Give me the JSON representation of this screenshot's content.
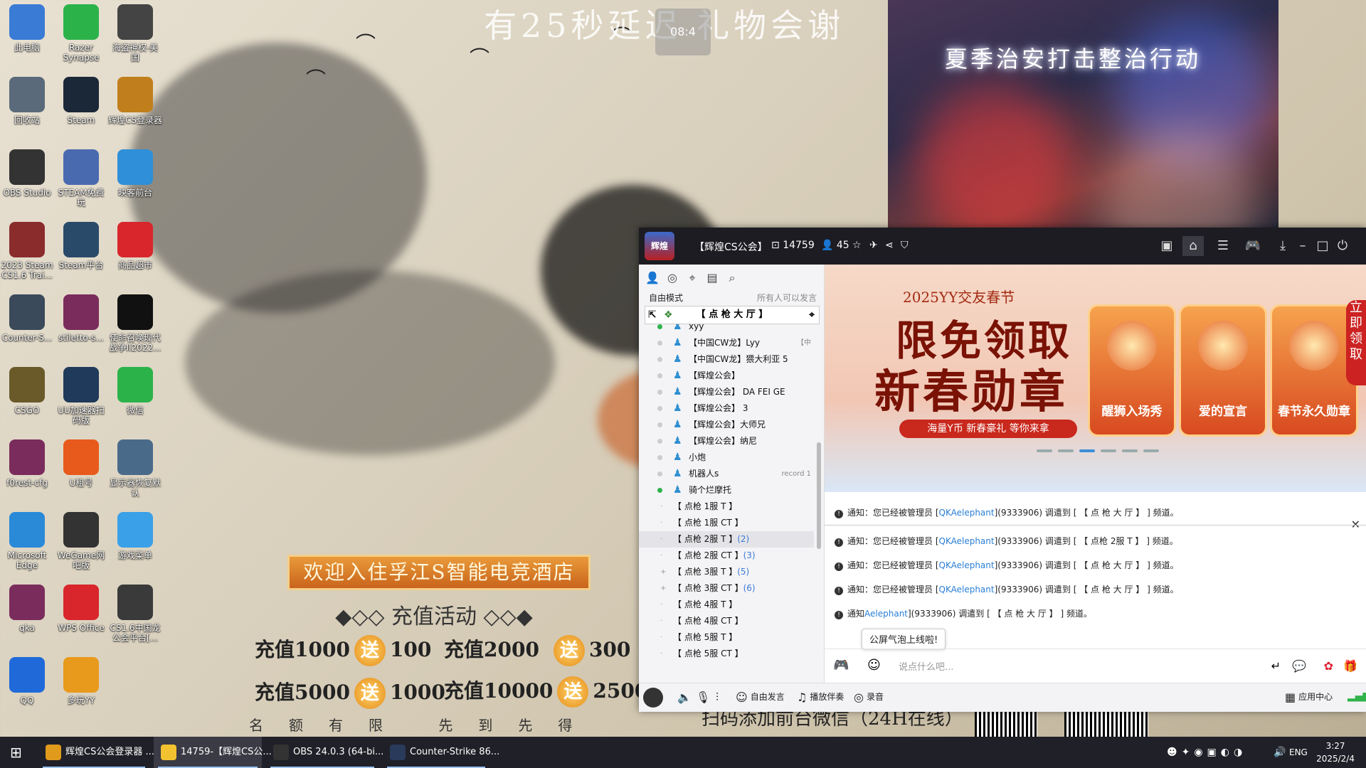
{
  "background": {
    "title": "有25秒延迟 礼物会谢",
    "timer": "08:4",
    "video_caption": "夏季治安打击整治行动"
  },
  "desktop_icons": [
    {
      "label": "此电脑",
      "icon": "computer-icon"
    },
    {
      "label": "Razer Synapse",
      "icon": "razer-icon"
    },
    {
      "label": "海盗神权-美国",
      "icon": "pirate-ship-icon"
    },
    {
      "label": "回收站",
      "icon": "recycle-bin-icon"
    },
    {
      "label": "Steam",
      "icon": "steam-icon"
    },
    {
      "label": "辉煌CS登录器",
      "icon": "huihuang-icon"
    },
    {
      "label": "OBS Studio",
      "icon": "obs-icon"
    },
    {
      "label": "STEAM免费玩",
      "icon": "steam-free-icon"
    },
    {
      "label": "映客前台",
      "icon": "inke-icon"
    },
    {
      "label": "2023 Steam CS1.6 Trai...",
      "icon": "winrar-icon"
    },
    {
      "label": "Steam平台",
      "icon": "steam-platform-icon"
    },
    {
      "label": "商品超市",
      "icon": "shopping-cart-icon"
    },
    {
      "label": "Counter-S...",
      "icon": "counter-strike-icon"
    },
    {
      "label": "stiletto-s...",
      "icon": "winrar-icon"
    },
    {
      "label": "使命召唤现代战争II2022...",
      "icon": "call-of-duty-icon"
    },
    {
      "label": "CSGO",
      "icon": "csgo-icon"
    },
    {
      "label": "UU加速器扫码版",
      "icon": "uu-accelerator-icon"
    },
    {
      "label": "微信",
      "icon": "wechat-icon"
    },
    {
      "label": "f0rest-cfg",
      "icon": "winrar-icon"
    },
    {
      "label": "U租号",
      "icon": "u-rent-icon"
    },
    {
      "label": "显示器恢复默认",
      "icon": "monitor-icon"
    },
    {
      "label": "Microsoft Edge",
      "icon": "edge-icon"
    },
    {
      "label": "WeGame网吧版",
      "icon": "wegame-icon"
    },
    {
      "label": "游戏菜单",
      "icon": "cloud-icon"
    },
    {
      "label": "qka",
      "icon": "winrar-icon"
    },
    {
      "label": "WPS Office",
      "icon": "wps-icon"
    },
    {
      "label": "CS1.6中国龙公会平台[...",
      "icon": "cs-dragon-icon"
    },
    {
      "label": "QQ",
      "icon": "qq-icon"
    },
    {
      "label": "多玩YY",
      "icon": "duowan-yy-icon"
    }
  ],
  "poster": {
    "banner": "欢迎入住孚江S智能电竞酒店",
    "subtitle": "充值活动",
    "gift_word": "送",
    "offers": [
      {
        "pay": "充值1000",
        "gift": "100"
      },
      {
        "pay": "充值2000",
        "gift": "300"
      },
      {
        "pay": "充值5000",
        "gift": "1000"
      },
      {
        "pay": "充值10000",
        "gift": "2500"
      }
    ],
    "limit_text": "名额有限 先到先得",
    "bottom_text": "扫码添加前台微信（24H在线）"
  },
  "yy": {
    "title": "【辉煌CS公会】",
    "channel_id": "14759",
    "online_count": "45",
    "mode_label": "自由模式",
    "mode_right": "所有人可以发言",
    "room_name": "【 点 枪 大 厅 】",
    "users": [
      {
        "name": "xyy",
        "online": true,
        "extra": ""
      },
      {
        "name": "【中国CW龙】Lyy",
        "online": false,
        "extra": "【中"
      },
      {
        "name": "【中国CW龙】猥大利亚 5",
        "online": false,
        "extra": ""
      },
      {
        "name": "【辉煌公会】",
        "online": false,
        "extra": ""
      },
      {
        "name": "【辉煌公会】 DA FEI GE",
        "online": false,
        "extra": ""
      },
      {
        "name": "【辉煌公会】 3",
        "online": false,
        "extra": ""
      },
      {
        "name": "【辉煌公会】大师兄",
        "online": false,
        "extra": ""
      },
      {
        "name": "【辉煌公会】纳尼",
        "online": false,
        "extra": ""
      },
      {
        "name": "小炮",
        "online": false,
        "extra": ""
      },
      {
        "name": "机器人s",
        "online": false,
        "extra": "record 1"
      },
      {
        "name": "骑个烂摩托",
        "online": true,
        "extra": ""
      }
    ],
    "channels": [
      {
        "name": "【 点枪 1服  T   】",
        "count": ""
      },
      {
        "name": "【 点枪 1服  CT  】",
        "count": ""
      },
      {
        "name": "【 点枪 2服  T   】",
        "count": "(2)"
      },
      {
        "name": "【 点枪 2服  CT  】",
        "count": "(3)"
      },
      {
        "name": "【 点枪 3服  T   】",
        "count": "(5)"
      },
      {
        "name": "【 点枪 3服  CT  】",
        "count": "(6)"
      },
      {
        "name": "【 点枪 4服  T   】",
        "count": ""
      },
      {
        "name": "【 点枪 4服  CT  】",
        "count": ""
      },
      {
        "name": "【 点枪 5服  T   】",
        "count": ""
      },
      {
        "name": "【 点枪 5服  CT  】",
        "count": ""
      }
    ],
    "promo": {
      "top": "2025YY交友春节",
      "big1": "限免领取",
      "big2": "新春勋章",
      "ribbon": "海量Y币 新春豪礼 等你来拿",
      "cards": [
        "醒狮入场秀",
        "爱的宣言",
        "春节永久勋章"
      ],
      "side": "立即领取"
    },
    "messages_top": [
      {
        "prefix": "通知：您已经被管理员 [",
        "link": "QKAelephant",
        "suffix": "](9333906) 调遣到 [ 【 点 枪 大 厅 】 ] 频道。"
      }
    ],
    "messages": [
      {
        "prefix": "通知：您已经被管理员 [",
        "link": "QKAelephant",
        "suffix": "](9333906) 调遣到 [ 【 点枪 2服  T  】 ] 频道。"
      },
      {
        "prefix": "通知：您已经被管理员 [",
        "link": "QKAelephant",
        "suffix": "](9333906) 调遣到 [ 【 点 枪 大 厅 】 ] 频道。"
      },
      {
        "prefix": "通知：您已经被管理员 [",
        "link": "QKAelephant",
        "suffix": "](9333906) 调遣到 [ 【 点 枪 大 厅 】 ] 频道。"
      },
      {
        "prefix": "通知",
        "link": "Aelephant",
        "suffix": "](9333906) 调遣到 [ 【 点 枪 大 厅 】 ] 频道。"
      }
    ],
    "tooltip": "公屏气泡上线啦!",
    "input_placeholder": "说点什么吧...",
    "bottom": {
      "free_speak": "自由发言",
      "accompany": "播放伴奏",
      "record": "录音",
      "app_center": "应用中心"
    }
  },
  "taskbar": {
    "items": [
      {
        "label": "辉煌CS公会登录器 ...",
        "active": false
      },
      {
        "label": "14759-【辉煌CS公...",
        "active": true
      },
      {
        "label": "OBS 24.0.3 (64-bi...",
        "active": false
      },
      {
        "label": "Counter-Strike 86...",
        "active": false
      }
    ],
    "lang": "ENG",
    "time": "3:27",
    "date": "2025/2/4"
  }
}
